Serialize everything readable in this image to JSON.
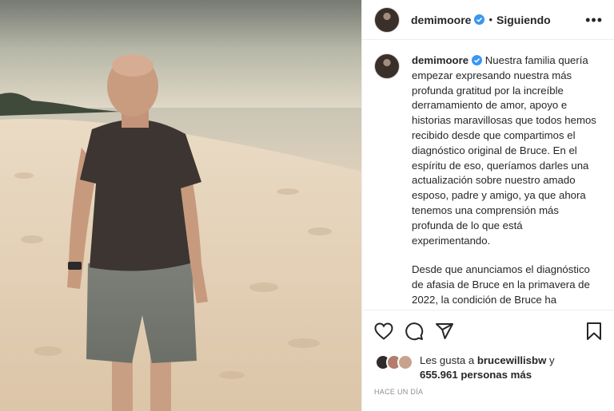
{
  "post": {
    "username": "demimoore",
    "separator": "•",
    "follow_status": "Siguiendo",
    "more_icon": "•••",
    "caption_paragraphs": [
      "Nuestra familia quería empezar expresando nuestra más profunda gratitud por la increíble derramamiento de amor, apoyo e historias maravillosas que todos hemos recibido desde que compartimos el diagnóstico original de Bruce. En el espíritu de eso, queríamos darles una actualización sobre nuestro amado esposo, padre y amigo, ya que ahora tenemos una comprensión más profunda de lo que está experimentando.",
      "Desde que anunciamos el diagnóstico de afasia de Bruce en la primavera de 2022, la condición de Bruce ha progresado y ahora tenemos un diagnóstico más específico: demencia"
    ],
    "likes_prefix": "Les gusta a",
    "liked_by_user": "brucewillisbw",
    "likes_conjunction": "y",
    "likes_count_text": "655.961 personas más",
    "date_text": "HACE UN DÍA"
  },
  "icons": {
    "verified": "verified-badge-icon",
    "like": "heart-icon",
    "comment": "comment-bubble-icon",
    "share": "paper-plane-icon",
    "save": "bookmark-icon"
  },
  "colors": {
    "verified": "#3897f0",
    "text": "#262626",
    "muted": "#8e8e8e",
    "border": "#efefef"
  }
}
